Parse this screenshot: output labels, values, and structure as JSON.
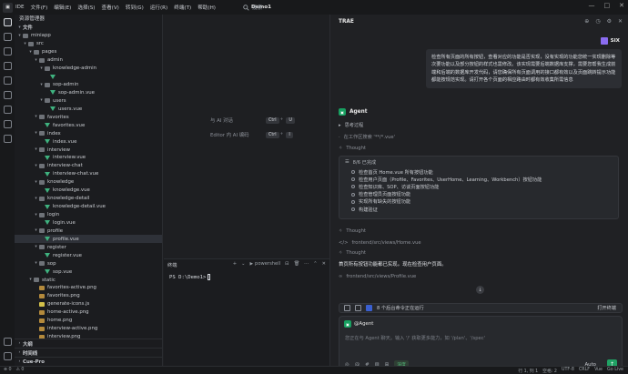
{
  "app": {
    "logo": "IDE",
    "title": "IDE"
  },
  "menu": [
    "文件(F)",
    "编辑(E)",
    "选择(S)",
    "查看(V)",
    "转到(G)",
    "运行(R)",
    "终端(T)",
    "帮助(H)"
  ],
  "project_name": "Demo1",
  "search": {
    "placeholder": "搜索"
  },
  "explorer": {
    "title": "资源管理器",
    "section_files": "文件",
    "tree": [
      {
        "label": "miniapp",
        "depth": 0,
        "type": "folder",
        "open": true
      },
      {
        "label": "src",
        "depth": 1,
        "type": "folder",
        "open": true
      },
      {
        "label": "pages",
        "depth": 2,
        "type": "folder",
        "open": true
      },
      {
        "label": "admin",
        "depth": 3,
        "type": "folder",
        "open": true
      },
      {
        "label": "knowledge-admin",
        "depth": 4,
        "type": "folder",
        "open": true
      },
      {
        "label": "",
        "depth": 5,
        "type": "vue",
        "open": false
      },
      {
        "label": "sop-admin",
        "depth": 4,
        "type": "folder",
        "open": true
      },
      {
        "label": "sop-admin.vue",
        "depth": 5,
        "type": "vue",
        "open": false
      },
      {
        "label": "users",
        "depth": 4,
        "type": "folder",
        "open": true
      },
      {
        "label": "users.vue",
        "depth": 5,
        "type": "vue",
        "open": false
      },
      {
        "label": "favorites",
        "depth": 3,
        "type": "folder",
        "open": true
      },
      {
        "label": "favorites.vue",
        "depth": 4,
        "type": "vue",
        "open": false
      },
      {
        "label": "index",
        "depth": 3,
        "type": "folder",
        "open": true
      },
      {
        "label": "index.vue",
        "depth": 4,
        "type": "vue",
        "open": false
      },
      {
        "label": "interview",
        "depth": 3,
        "type": "folder",
        "open": true
      },
      {
        "label": "interview.vue",
        "depth": 4,
        "type": "vue",
        "open": false
      },
      {
        "label": "interview-chat",
        "depth": 3,
        "type": "folder",
        "open": true
      },
      {
        "label": "interview-chat.vue",
        "depth": 4,
        "type": "vue",
        "open": false
      },
      {
        "label": "knowledge",
        "depth": 3,
        "type": "folder",
        "open": true
      },
      {
        "label": "knowledge.vue",
        "depth": 4,
        "type": "vue",
        "open": false
      },
      {
        "label": "knowledge-detail",
        "depth": 3,
        "type": "folder",
        "open": true
      },
      {
        "label": "knowledge-detail.vue",
        "depth": 4,
        "type": "vue",
        "open": false
      },
      {
        "label": "login",
        "depth": 3,
        "type": "folder",
        "open": true
      },
      {
        "label": "login.vue",
        "depth": 4,
        "type": "vue",
        "open": false
      },
      {
        "label": "profile",
        "depth": 3,
        "type": "folder",
        "open": true
      },
      {
        "label": "profile.vue",
        "depth": 4,
        "type": "vue",
        "open": false,
        "selected": true
      },
      {
        "label": "register",
        "depth": 3,
        "type": "folder",
        "open": true
      },
      {
        "label": "register.vue",
        "depth": 4,
        "type": "vue",
        "open": false
      },
      {
        "label": "sop",
        "depth": 3,
        "type": "folder",
        "open": true
      },
      {
        "label": "sop.vue",
        "depth": 4,
        "type": "vue",
        "open": false
      },
      {
        "label": "static",
        "depth": 2,
        "type": "folder",
        "open": true
      },
      {
        "label": "favorites-active.png",
        "depth": 3,
        "type": "png",
        "open": false
      },
      {
        "label": "favorites.png",
        "depth": 3,
        "type": "png",
        "open": false
      },
      {
        "label": "generate-icons.js",
        "depth": 3,
        "type": "js",
        "open": false
      },
      {
        "label": "home-active.png",
        "depth": 3,
        "type": "png",
        "open": false
      },
      {
        "label": "home.png",
        "depth": 3,
        "type": "png",
        "open": false
      },
      {
        "label": "interview-active.png",
        "depth": 3,
        "type": "png",
        "open": false
      },
      {
        "label": "interview.png",
        "depth": 3,
        "type": "png",
        "open": false
      }
    ],
    "bottom_sections": [
      "大纲",
      "时间线",
      "Cue-Pro"
    ]
  },
  "editor_hints": [
    {
      "label": "与 AI 对话",
      "keys": [
        "Ctrl",
        "U"
      ]
    },
    {
      "label": "Editor 内 AI 编码",
      "keys": [
        "Ctrl",
        "I"
      ]
    }
  ],
  "terminal": {
    "tab_label": "终端",
    "shell": "powershell",
    "prompt": "PS D:\\Demo1>"
  },
  "chat": {
    "title": "TRAE",
    "user_name": "SIX",
    "user_message": "检查所有页面的所有按钮，查看对应的功能是否实现，没有实现的功能您统一实现删除等次要功能以及部分按钮的样式也需修改。该实现需要后端数据库支撑，需要您帮我生成前端和后端的数据库开发代码，请您确保所有页面调用的接口都有效以及页面跳转提示功能都能按规范实现。请打开各个页面的相应路由时都有效收集所需信息",
    "agent_name": "Agent",
    "steps": [
      {
        "icon": "▸",
        "text": "思考过程"
      },
      {
        "icon": "·",
        "text": "在工作区搜索 '**/*.vue'"
      },
      {
        "icon": "✧",
        "text": "Thought"
      }
    ],
    "todo": {
      "count": "8/6 已完成",
      "items": [
        "检查首页 Home.vue 所有按钮功能",
        "检查用户页面（Profile、Favorites、UserHome、Learning、Workbench）按钮功能",
        "检查知识库、SOP、访谈页面按钮功能",
        "检查管理员页面按钮功能",
        "实现所有缺失的按钮功能",
        "构建验证"
      ]
    },
    "more_steps": [
      {
        "icon": "✧",
        "text": "Thought"
      },
      {
        "icon": "</>",
        "text": "frontend/src/views/Home.vue"
      },
      {
        "icon": "✧",
        "text": "Thought"
      }
    ],
    "agent_reply": "首页所有按钮功能都已实现。现在检查用户页面。",
    "file_ref": "frontend/src/views/Profile.vue",
    "pending_label": "8 个后台命令正在运行",
    "pending_action": "打开终端",
    "input_mention": "@Agent",
    "input_placeholder": "您正在与 Agent 聊天。输入 '/' 获取更多能力，如 '/plan'、'/spec'",
    "thinking_chip": "深度",
    "model": "Auto"
  },
  "status": {
    "left": [
      "⊗ 0",
      "⚠ 0"
    ],
    "right": [
      "行 1, 列 1",
      "空格: 2",
      "UTF-8",
      "CRLF",
      "Vue",
      "Go Live"
    ]
  },
  "colors": {
    "accent": "#20a264",
    "bg": "#1e1f22",
    "selection": "#2e3138",
    "vue": "#3fb27f"
  }
}
